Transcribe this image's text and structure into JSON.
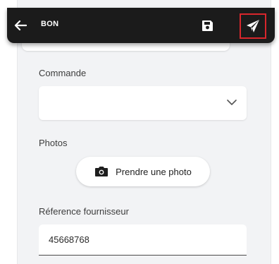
{
  "appbar": {
    "title": "BON",
    "back_icon": "arrow-left-icon",
    "save_icon": "floppy-disk-icon",
    "send_icon": "paper-plane-icon",
    "highlight_color": "#d8262c"
  },
  "form": {
    "commande": {
      "label": "Commande",
      "value": "",
      "icon": "chevron-down-icon"
    },
    "photos": {
      "label": "Photos",
      "button_label": "Prendre une photo",
      "icon": "camera-icon"
    },
    "reference": {
      "label": "Réference fournisseur",
      "value": "45668768"
    }
  }
}
